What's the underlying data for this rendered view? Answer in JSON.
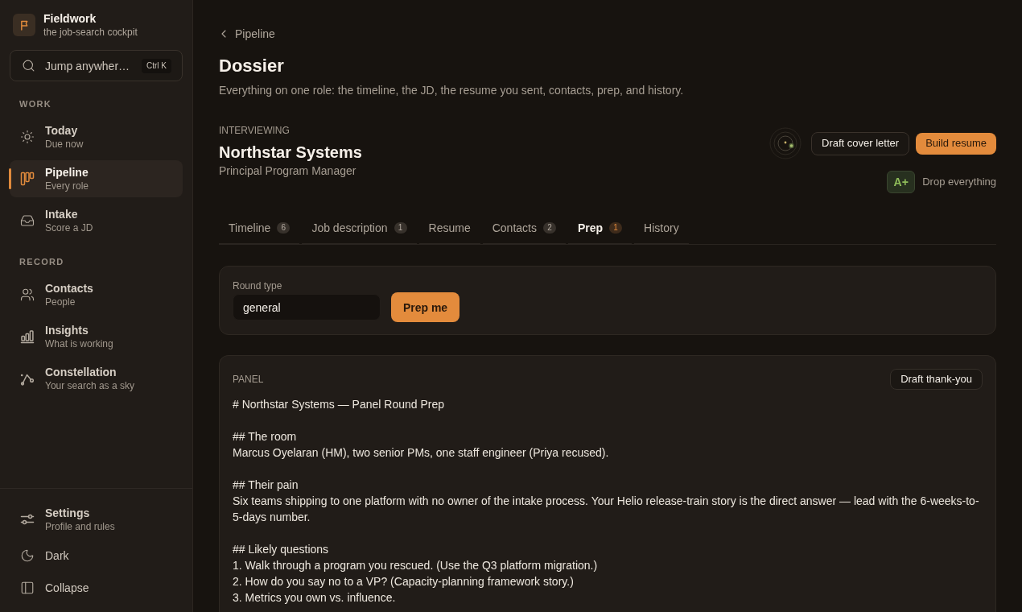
{
  "brand": {
    "name": "Fieldwork",
    "tagline": "the job-search cockpit"
  },
  "search": {
    "label": "Jump anywher…",
    "shortcut": "Ctrl K"
  },
  "sidebar": {
    "sections": [
      {
        "label": "WORK",
        "items": [
          {
            "title": "Today",
            "subtitle": "Due now",
            "selected": false
          },
          {
            "title": "Pipeline",
            "subtitle": "Every role",
            "selected": true
          },
          {
            "title": "Intake",
            "subtitle": "Score a JD",
            "selected": false
          }
        ]
      },
      {
        "label": "RECORD",
        "items": [
          {
            "title": "Contacts",
            "subtitle": "People",
            "selected": false
          },
          {
            "title": "Insights",
            "subtitle": "What is working",
            "selected": false
          },
          {
            "title": "Constellation",
            "subtitle": "Your search as a sky",
            "selected": false
          }
        ]
      }
    ],
    "footer": [
      {
        "title": "Settings",
        "subtitle": "Profile and rules"
      },
      {
        "title": "Dark"
      },
      {
        "title": "Collapse"
      }
    ]
  },
  "breadcrumb": {
    "label": "Pipeline"
  },
  "page": {
    "title": "Dossier",
    "description": "Everything on one role: the timeline, the JD, the resume you sent, contacts, prep, and history."
  },
  "role": {
    "status": "INTERVIEWING",
    "company": "Northstar Systems",
    "position": "Principal Program Manager",
    "grade": "A+",
    "verdict": "Drop everything"
  },
  "actions": [
    {
      "label": "Draft cover letter",
      "kind": "secondary"
    },
    {
      "label": "Build resume",
      "kind": "primary"
    }
  ],
  "tabs": [
    {
      "label": "Timeline",
      "count": "6",
      "selected": false
    },
    {
      "label": "Job description",
      "count": "1",
      "selected": false
    },
    {
      "label": "Resume",
      "selected": false
    },
    {
      "label": "Contacts",
      "count": "2",
      "selected": false
    },
    {
      "label": "Prep",
      "count": "1",
      "selected": true
    },
    {
      "label": "History",
      "selected": false
    }
  ],
  "round_form": {
    "label": "Round type",
    "value": "general",
    "button": "Prep me"
  },
  "panel": {
    "label": "PANEL",
    "action": "Draft thank-you",
    "sections": [
      {
        "lines": [
          "# Northstar Systems — Panel Round Prep"
        ]
      },
      {
        "lines": [
          "## The room",
          "Marcus Oyelaran (HM), two senior PMs, one staff engineer (Priya recused)."
        ]
      },
      {
        "lines": [
          "## Their pain",
          "Six teams shipping to one platform with no owner of the intake process. Your Helio release-train story is the direct answer — lead with the 6-weeks-to-5-days number."
        ]
      },
      {
        "lines": [
          "## Likely questions",
          "1. Walk through a program you rescued. (Use the Q3 platform migration.)",
          "2. How do you say no to a VP? (Capacity-planning framework story.)",
          "3. Metrics you own vs. influence."
        ]
      }
    ]
  }
}
